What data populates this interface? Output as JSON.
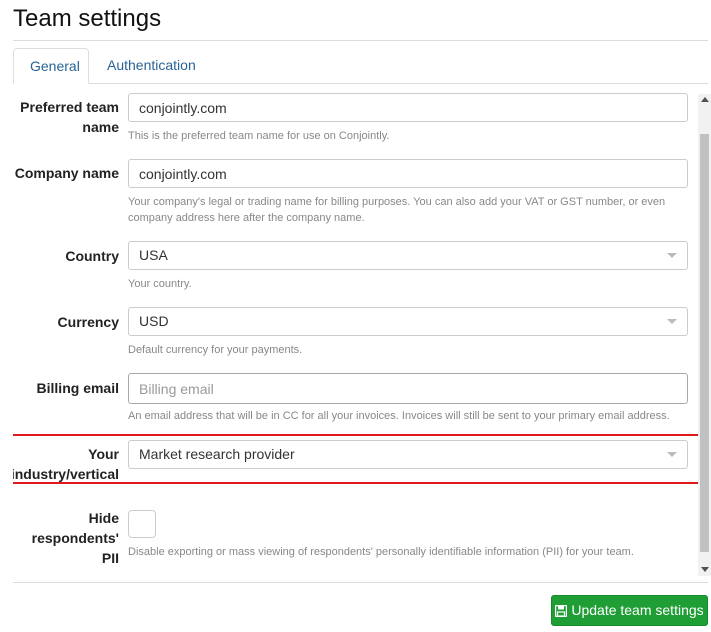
{
  "page": {
    "title": "Team settings"
  },
  "tabs": [
    {
      "label": "General",
      "active": true
    },
    {
      "label": "Authentication",
      "active": false
    }
  ],
  "form": {
    "preferred_team_name": {
      "label_line1": "Preferred team",
      "label_line2": "name",
      "value": "conjointly.com",
      "help": "This is the preferred team name for use on Conjointly."
    },
    "company_name": {
      "label": "Company name",
      "value": "conjointly.com",
      "help_line1": "Your company's legal or trading name for billing purposes. You can also add your VAT or GST number, or even",
      "help_line2": "company address here after the company name."
    },
    "country": {
      "label": "Country",
      "value": "USA",
      "help": "Your country."
    },
    "currency": {
      "label": "Currency",
      "value": "USD",
      "help": "Default currency for your payments."
    },
    "billing_email": {
      "label": "Billing email",
      "value": "",
      "placeholder": "Billing email",
      "help": "An email address that will be in CC for all your invoices. Invoices will still be sent to your primary email address."
    },
    "industry": {
      "label_line1": "Your",
      "label_line2": "industry/vertical",
      "value": "Market research provider"
    },
    "hide_pii": {
      "label_line1": "Hide",
      "label_line2": "respondents' PII",
      "checked": false,
      "help": "Disable exporting or mass viewing of respondents' personally identifiable information (PII) for your team."
    }
  },
  "footer": {
    "update_button_label": "Update team settings"
  },
  "colors": {
    "accent_green": "#1e9e35",
    "highlight_red": "#e0191f",
    "link_blue": "#2a6496"
  }
}
